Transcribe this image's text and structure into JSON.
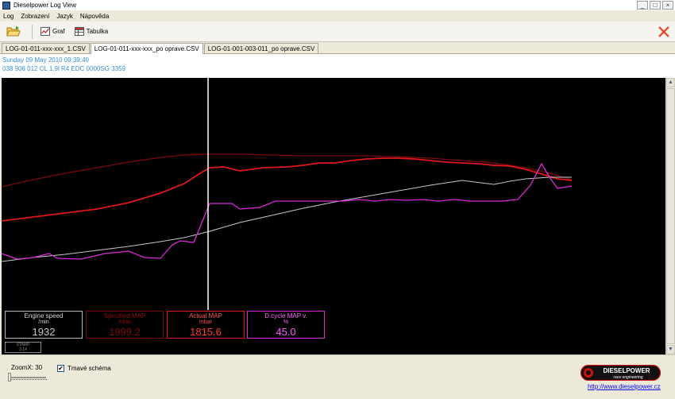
{
  "window": {
    "title": "Dieselpower Log View",
    "min": "_",
    "max": "□",
    "close": "×"
  },
  "menu": [
    "Log",
    "Zobrazení",
    "Jazyk",
    "Nápověda"
  ],
  "toolbar": {
    "graph_label": "Graf",
    "table_label": "Tabulka"
  },
  "tabs": [
    {
      "label": "LOG-01-011-xxx-xxx_1.CSV",
      "active": false
    },
    {
      "label": "LOG-01-011-xxx-xxx_po oprave.CSV",
      "active": true
    },
    {
      "label": "LOG-01-001-003-011_po oprave.CSV",
      "active": false
    }
  ],
  "info": {
    "date": "Sunday 09 May 2010 09:39:40",
    "ecu": "038 906 012 CL  1.9l R4 EDC 0000SG  3359"
  },
  "colors": {
    "engine_speed": "#c8c8c8",
    "specified_map": "#7a0a0a",
    "actual_map": "#e0181b",
    "duty_cycle": "#d92bd8",
    "background": "#000000",
    "cursor": "#ffffff"
  },
  "boxes": {
    "engine_speed": {
      "name": "Engine speed",
      "unit": "/min",
      "value": "1932"
    },
    "specified_map": {
      "name": "Specified MAP",
      "unit": "mbar",
      "value": "1999.2"
    },
    "actual_map": {
      "name": "Actual MAP",
      "unit": "mbar",
      "value": "1815.6"
    },
    "duty_cycle": {
      "name": "D.cycle MAP v.",
      "unit": "%",
      "value": "45.0"
    }
  },
  "stamp": {
    "label": "STAMP",
    "value": "3.14"
  },
  "bottom": {
    "zoom_label": "ZoomX: 30",
    "zoom_value": 30,
    "dark_scheme_label": "Tmavé schéma",
    "dark_scheme_checked": true,
    "logo_main": "DIESELPOWER",
    "logo_sub": "race engineering",
    "website": "http://www.dieselpower.cz"
  }
}
